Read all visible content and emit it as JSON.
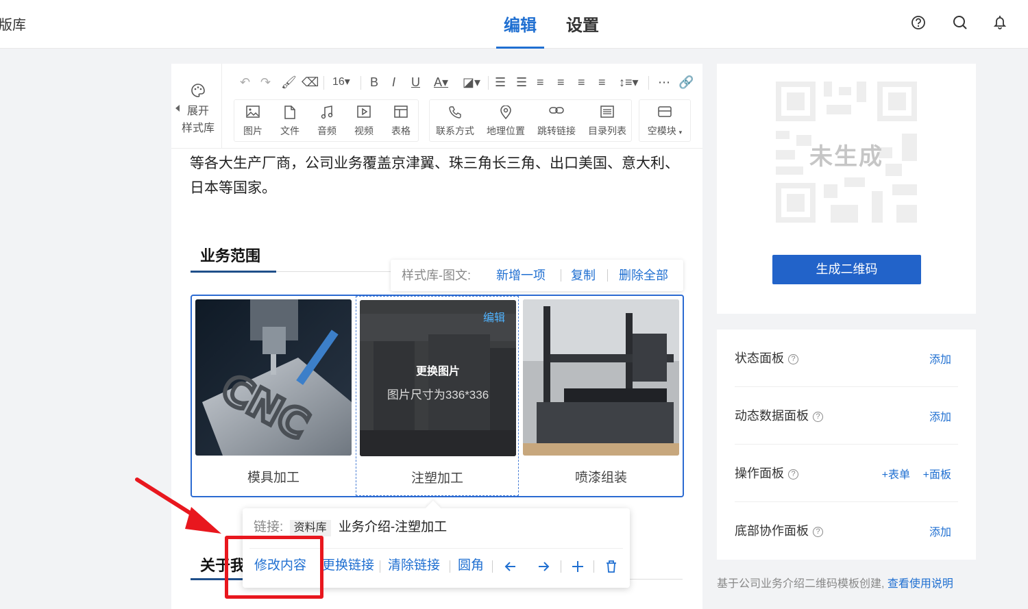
{
  "header": {
    "brand": "版库",
    "tabs": [
      {
        "label": "编辑",
        "active": true
      },
      {
        "label": "设置",
        "active": false
      }
    ],
    "icons": [
      "help-icon",
      "search-icon",
      "bell-icon"
    ]
  },
  "toolbar": {
    "style_library": {
      "line1": "展开",
      "line2": "样式库"
    },
    "font_size": "16",
    "insert_buttons": [
      {
        "label": "图片",
        "icon": "image-icon"
      },
      {
        "label": "文件",
        "icon": "file-icon"
      },
      {
        "label": "音频",
        "icon": "music-icon"
      },
      {
        "label": "视频",
        "icon": "video-icon"
      },
      {
        "label": "表格",
        "icon": "table-icon"
      }
    ],
    "widget_buttons": [
      {
        "label": "联系方式",
        "icon": "phone-icon"
      },
      {
        "label": "地理位置",
        "icon": "location-icon"
      },
      {
        "label": "跳转链接",
        "icon": "link-icon"
      },
      {
        "label": "目录列表",
        "icon": "list-icon"
      }
    ],
    "block_button": {
      "label": "空模块",
      "icon": "block-icon"
    }
  },
  "content": {
    "paragraph": "等各大生产厂商，公司业务覆盖京津翼、珠三角长三角、出口美国、意大利、日本等国家。",
    "section_title": "业务范围",
    "about_title": "关于我"
  },
  "style_bar": {
    "label": "样式库-图文:",
    "actions": [
      "新增一项",
      "复制",
      "删除全部"
    ]
  },
  "gallery": {
    "items": [
      {
        "caption": "模具加工"
      },
      {
        "caption": "注塑加工",
        "selected": true,
        "edit_label": "编辑",
        "replace_label": "更换图片",
        "size_hint": "图片尺寸为336*336"
      },
      {
        "caption": "喷漆组装"
      }
    ]
  },
  "link_popup": {
    "label": "链接:",
    "tag": "资料库",
    "value": "业务介绍-注塑加工",
    "actions": [
      "修改内容",
      "更换链接",
      "清除链接",
      "圆角"
    ]
  },
  "qr": {
    "placeholder": "未生成",
    "button": "生成二维码"
  },
  "panels": [
    {
      "name": "状态面板",
      "actions": [
        "添加"
      ]
    },
    {
      "name": "动态数据面板",
      "actions": [
        "添加"
      ]
    },
    {
      "name": "操作面板",
      "actions": [
        "+表单",
        "+面板"
      ]
    },
    {
      "name": "底部协作面板",
      "actions": [
        "添加"
      ]
    }
  ],
  "footer": {
    "text": "基于公司业务介绍二维码模板创建,",
    "link": "查看使用说明"
  },
  "colors": {
    "accent": "#1f6fd1",
    "highlight": "#e8171e"
  }
}
